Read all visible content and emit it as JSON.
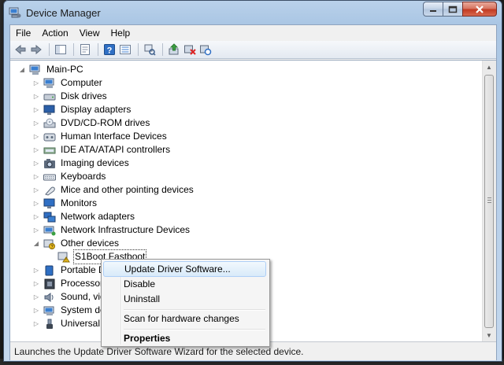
{
  "window": {
    "title": "Device Manager"
  },
  "menubar": {
    "items": [
      "File",
      "Action",
      "View",
      "Help"
    ]
  },
  "toolbar": {
    "icons": [
      "back-arrow-icon",
      "forward-arrow-icon",
      "show-hide-console-tree-icon",
      "properties-icon",
      "help-icon",
      "view-icon",
      "update-driver-icon",
      "uninstall-icon",
      "scan-hardware-icon"
    ]
  },
  "tree": {
    "root": "Main-PC",
    "items": [
      "Computer",
      "Disk drives",
      "Display adapters",
      "DVD/CD-ROM drives",
      "Human Interface Devices",
      "IDE ATA/ATAPI controllers",
      "Imaging devices",
      "Keyboards",
      "Mice and other pointing devices",
      "Monitors",
      "Network adapters",
      "Network Infrastructure Devices",
      "Other devices",
      "S1Boot Fastboot",
      "Portable D",
      "Processors",
      "Sound, vid",
      "System de",
      "Universal S"
    ]
  },
  "context_menu": {
    "update_driver": "Update Driver Software...",
    "disable": "Disable",
    "uninstall": "Uninstall",
    "scan": "Scan for hardware changes",
    "properties": "Properties"
  },
  "statusbar": {
    "text": "Launches the Update Driver Software Wizard for the selected device."
  }
}
